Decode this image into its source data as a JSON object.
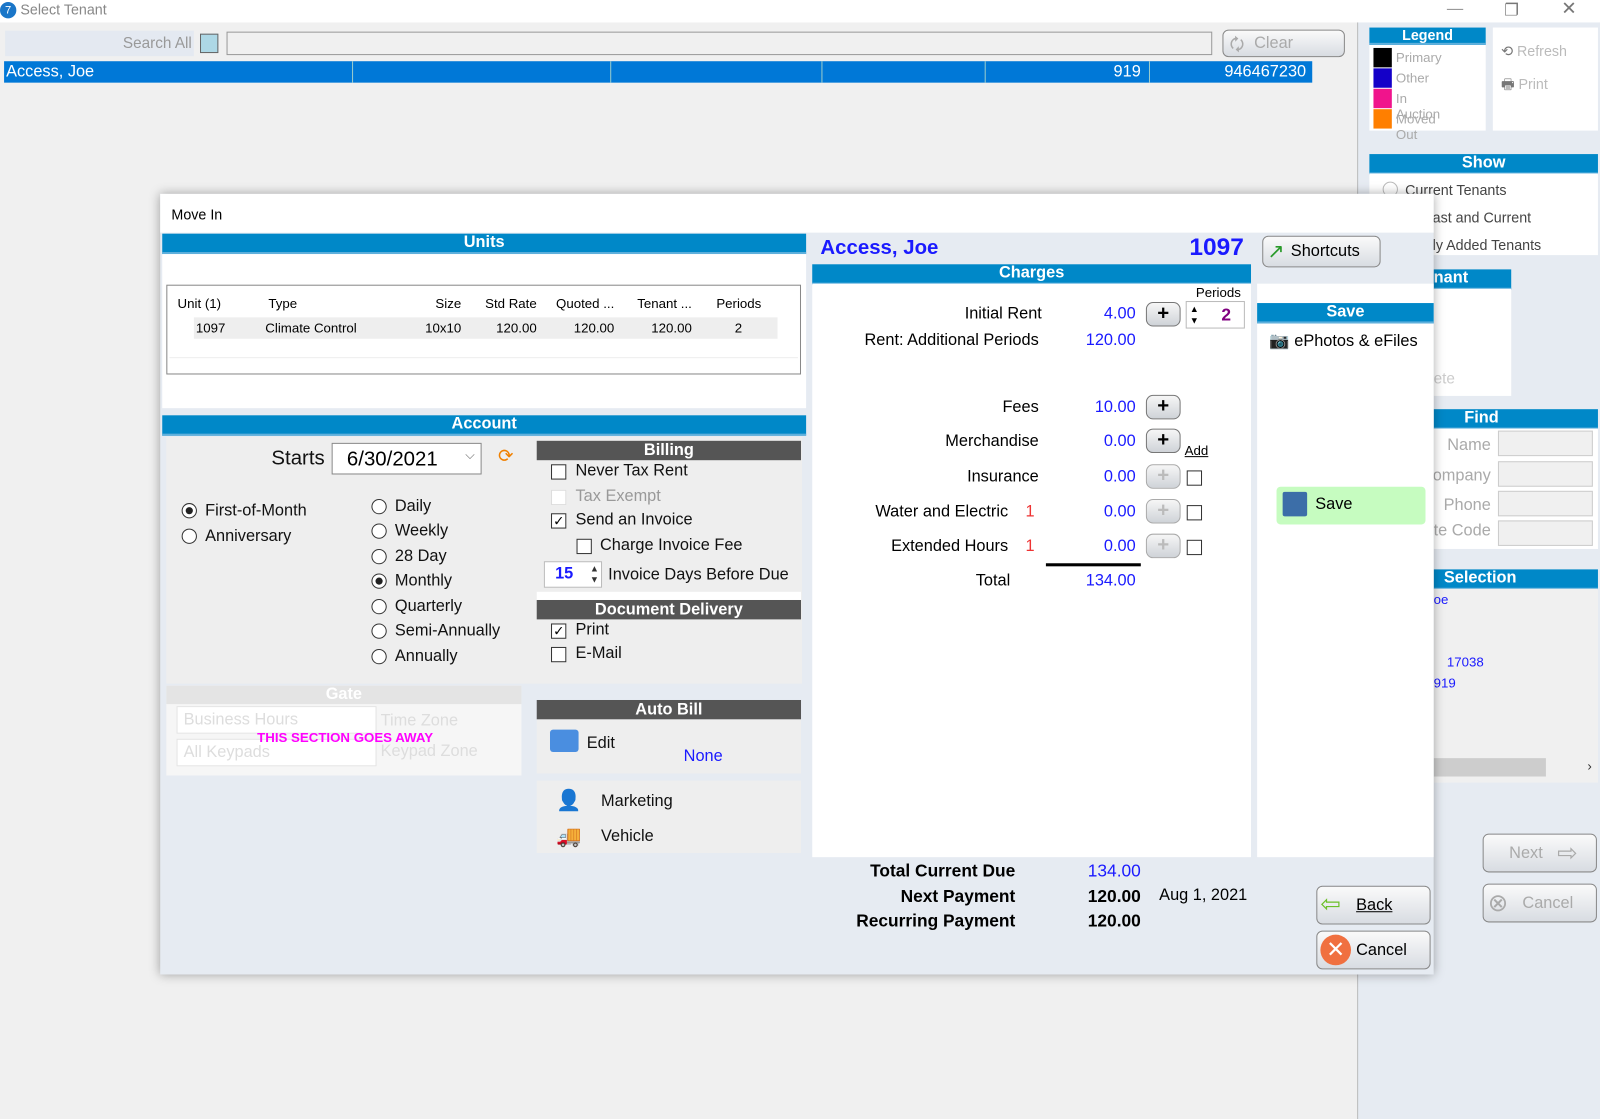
{
  "window": {
    "title": "Select Tenant"
  },
  "search": {
    "label": "Search All",
    "value": "",
    "clear_label": "Clear"
  },
  "tenant_row": {
    "name": "Access, Joe",
    "col6": "919",
    "col7": "946467230"
  },
  "legend": {
    "title": "Legend",
    "items": [
      {
        "label": "Primary",
        "color": "#000000"
      },
      {
        "label": "Other",
        "color": "#1400c8"
      },
      {
        "label": "In Auction",
        "color": "#f0148c"
      },
      {
        "label": "Moved Out",
        "color": "#ff7f00"
      }
    ]
  },
  "side_actions": {
    "refresh": "Refresh",
    "print": "Print"
  },
  "show": {
    "title": "Show",
    "options": [
      "Current Tenants",
      "ast and Current",
      "ly Added Tenants"
    ]
  },
  "tenant_panel": {
    "title": "nant",
    "delete": "ete"
  },
  "find": {
    "title": "Find",
    "fields": [
      "Name",
      "ompany",
      "Phone",
      "te Code"
    ]
  },
  "selection": {
    "title": "Selection",
    "line1": "oe",
    "line2": "17038",
    "line3": "919"
  },
  "nav": {
    "next": "Next",
    "cancel": "Cancel"
  },
  "modal": {
    "title": "Move In",
    "units": {
      "title": "Units",
      "columns": [
        "Unit (1)",
        "Type",
        "Size",
        "Std Rate",
        "Quoted ...",
        "Tenant ...",
        "Periods"
      ],
      "rows": [
        [
          "1097",
          "Climate Control",
          "10x10",
          "120.00",
          "120.00",
          "120.00",
          "2"
        ]
      ]
    },
    "account": {
      "title": "Account",
      "starts_label": "Starts",
      "starts_value": "6/30/2021",
      "billing_day": [
        "First-of-Month",
        "Anniversary"
      ],
      "frequency": [
        "Daily",
        "Weekly",
        "28 Day",
        "Monthly",
        "Quarterly",
        "Semi-Annually",
        "Annually"
      ]
    },
    "billing": {
      "title": "Billing",
      "never_tax": "Never Tax Rent",
      "tax_exempt": "Tax Exempt",
      "send_invoice": "Send an Invoice",
      "charge_fee": "Charge Invoice Fee",
      "days_value": "15",
      "days_label": "Invoice Days Before Due"
    },
    "delivery": {
      "title": "Document Delivery",
      "print": "Print",
      "email": "E-Mail"
    },
    "gate": {
      "title": "Gate",
      "hours": "Business Hours",
      "time_zone": "Time Zone",
      "keypads": "All Keypads",
      "keypad_zone": "Keypad Zone",
      "notice": "THIS SECTION GOES AWAY"
    },
    "autobill": {
      "title": "Auto Bill",
      "edit": "Edit",
      "value": "None"
    },
    "extras": {
      "marketing": "Marketing",
      "vehicle": "Vehicle"
    },
    "tenant_name": "Access, Joe",
    "unit": "1097",
    "shortcuts": "Shortcuts",
    "charges": {
      "title": "Charges",
      "periods_label": "Periods",
      "periods_value": "2",
      "initial_rent_label": "Initial Rent",
      "initial_rent": "4.00",
      "additional_label": "Rent: Additional Periods",
      "additional": "120.00",
      "fees_label": "Fees",
      "fees": "10.00",
      "merch_label": "Merchandise",
      "merch": "0.00",
      "add_link": "Add",
      "insurance_label": "Insurance",
      "insurance": "0.00",
      "water_label": "Water and Electric",
      "water_qty": "1",
      "water": "0.00",
      "ext_label": "Extended Hours",
      "ext_qty": "1",
      "ext": "0.00",
      "total_label": "Total",
      "total": "134.00"
    },
    "save_panel": {
      "title": "Save",
      "ephotos": "ePhotos & eFiles",
      "save": "Save"
    },
    "footer": {
      "due_label": "Total Current Due",
      "due": "134.00",
      "next_label": "Next Payment",
      "next": "120.00",
      "next_date": "Aug 1, 2021",
      "rec_label": "Recurring Payment",
      "rec": "120.00",
      "back": "Back",
      "cancel": "Cancel"
    }
  }
}
